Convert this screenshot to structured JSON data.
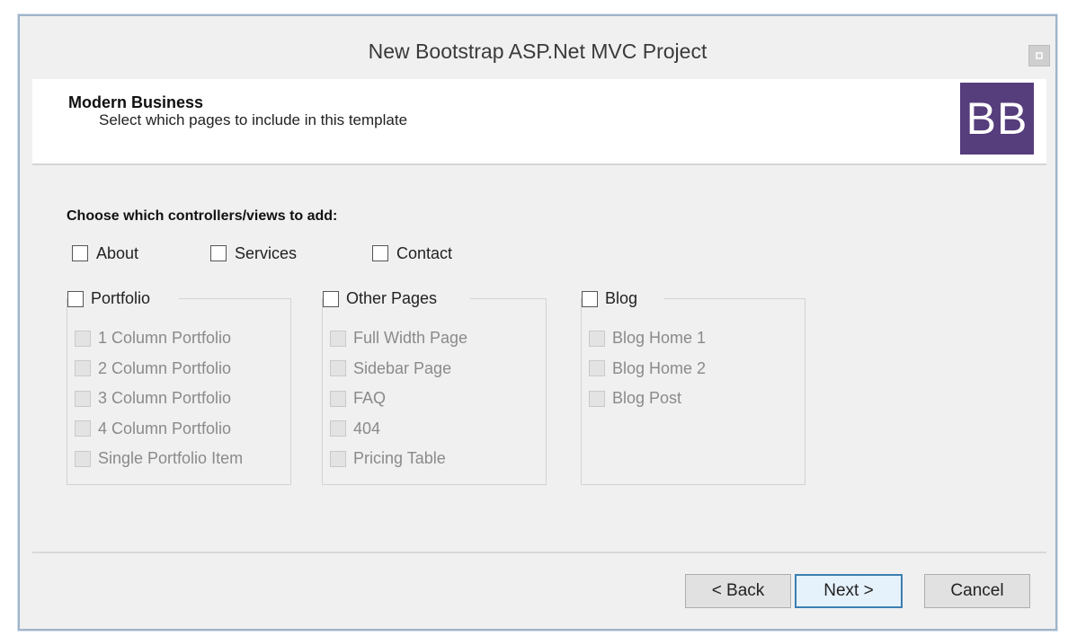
{
  "window": {
    "title": "New Bootstrap ASP.Net MVC Project",
    "close_icon": "close-icon"
  },
  "header": {
    "title": "Modern Business",
    "subtitle": "Select which pages to include in this template",
    "logo_text": "BB",
    "logo_color": "#563d7c"
  },
  "content": {
    "choose_label": "Choose which controllers/views to add:",
    "top_checks": [
      {
        "label": "About",
        "checked": false
      },
      {
        "label": "Services",
        "checked": false
      },
      {
        "label": "Contact",
        "checked": false
      }
    ],
    "groups": [
      {
        "label": "Portfolio",
        "checked": false,
        "items": [
          "1 Column Portfolio",
          "2 Column Portfolio",
          "3 Column Portfolio",
          "4 Column Portfolio",
          "Single Portfolio Item"
        ]
      },
      {
        "label": "Other Pages",
        "checked": false,
        "items": [
          "Full Width Page",
          "Sidebar Page",
          "FAQ",
          "404",
          "Pricing Table"
        ]
      },
      {
        "label": "Blog",
        "checked": false,
        "items": [
          "Blog Home 1",
          "Blog Home 2",
          "Blog Post"
        ]
      }
    ]
  },
  "footer": {
    "back_label": "< Back",
    "next_label": "Next >",
    "cancel_label": "Cancel"
  }
}
